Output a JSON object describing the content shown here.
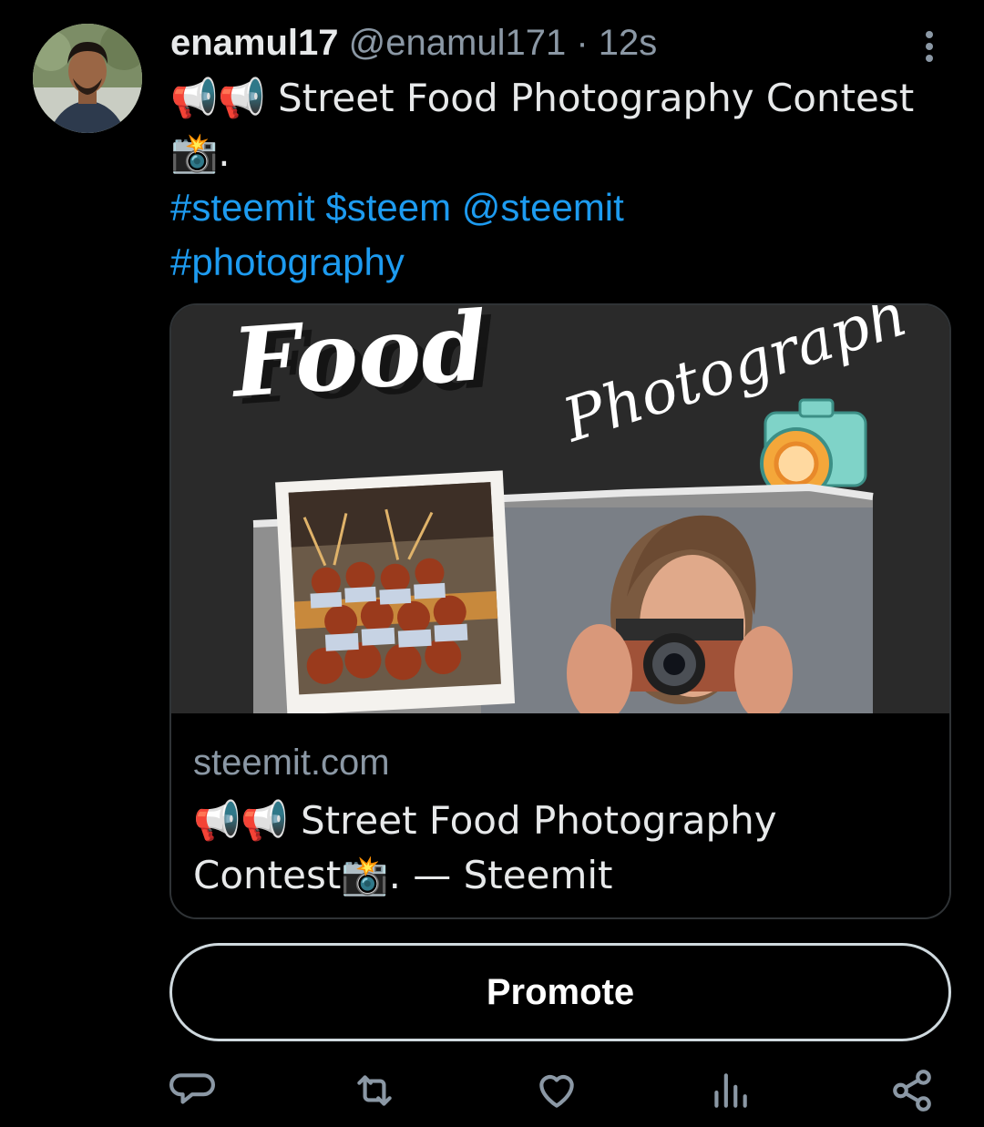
{
  "tweet": {
    "author_name": "enamul17",
    "handle": "@enamul171",
    "separator": "·",
    "time": "12s",
    "text_line1": "📢📢 Street Food Photography Contest",
    "text_line2": "📸.",
    "tags_line1": "#steemit $steem @steemit",
    "tags_line2": "#photography"
  },
  "card": {
    "image_text_big": "Food",
    "image_text_script": "Photograph",
    "domain": "steemit.com",
    "title_line1": "📢📢 Street Food Photography",
    "title_line2": "Contest📸. — Steemit"
  },
  "promote_label": "Promote",
  "icons": {
    "more": "more-vertical-icon",
    "reply": "reply-icon",
    "retweet": "retweet-icon",
    "like": "heart-icon",
    "analytics": "analytics-icon",
    "share": "share-icon"
  },
  "colors": {
    "background": "#000000",
    "text": "#e7e9ea",
    "secondary": "#8b98a5",
    "link": "#1d9bf0",
    "border": "#2f3336"
  }
}
